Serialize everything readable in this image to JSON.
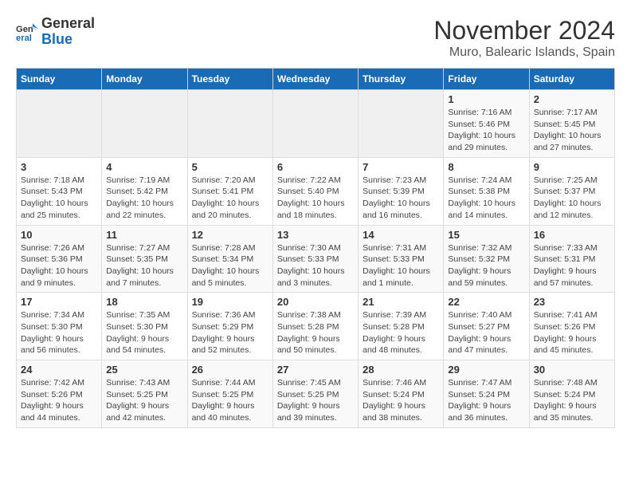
{
  "logo": {
    "line1": "General",
    "line2": "Blue"
  },
  "title": "November 2024",
  "location": "Muro, Balearic Islands, Spain",
  "days_of_week": [
    "Sunday",
    "Monday",
    "Tuesday",
    "Wednesday",
    "Thursday",
    "Friday",
    "Saturday"
  ],
  "weeks": [
    [
      {
        "day": "",
        "info": ""
      },
      {
        "day": "",
        "info": ""
      },
      {
        "day": "",
        "info": ""
      },
      {
        "day": "",
        "info": ""
      },
      {
        "day": "",
        "info": ""
      },
      {
        "day": "1",
        "info": "Sunrise: 7:16 AM\nSunset: 5:46 PM\nDaylight: 10 hours and 29 minutes."
      },
      {
        "day": "2",
        "info": "Sunrise: 7:17 AM\nSunset: 5:45 PM\nDaylight: 10 hours and 27 minutes."
      }
    ],
    [
      {
        "day": "3",
        "info": "Sunrise: 7:18 AM\nSunset: 5:43 PM\nDaylight: 10 hours and 25 minutes."
      },
      {
        "day": "4",
        "info": "Sunrise: 7:19 AM\nSunset: 5:42 PM\nDaylight: 10 hours and 22 minutes."
      },
      {
        "day": "5",
        "info": "Sunrise: 7:20 AM\nSunset: 5:41 PM\nDaylight: 10 hours and 20 minutes."
      },
      {
        "day": "6",
        "info": "Sunrise: 7:22 AM\nSunset: 5:40 PM\nDaylight: 10 hours and 18 minutes."
      },
      {
        "day": "7",
        "info": "Sunrise: 7:23 AM\nSunset: 5:39 PM\nDaylight: 10 hours and 16 minutes."
      },
      {
        "day": "8",
        "info": "Sunrise: 7:24 AM\nSunset: 5:38 PM\nDaylight: 10 hours and 14 minutes."
      },
      {
        "day": "9",
        "info": "Sunrise: 7:25 AM\nSunset: 5:37 PM\nDaylight: 10 hours and 12 minutes."
      }
    ],
    [
      {
        "day": "10",
        "info": "Sunrise: 7:26 AM\nSunset: 5:36 PM\nDaylight: 10 hours and 9 minutes."
      },
      {
        "day": "11",
        "info": "Sunrise: 7:27 AM\nSunset: 5:35 PM\nDaylight: 10 hours and 7 minutes."
      },
      {
        "day": "12",
        "info": "Sunrise: 7:28 AM\nSunset: 5:34 PM\nDaylight: 10 hours and 5 minutes."
      },
      {
        "day": "13",
        "info": "Sunrise: 7:30 AM\nSunset: 5:33 PM\nDaylight: 10 hours and 3 minutes."
      },
      {
        "day": "14",
        "info": "Sunrise: 7:31 AM\nSunset: 5:33 PM\nDaylight: 10 hours and 1 minute."
      },
      {
        "day": "15",
        "info": "Sunrise: 7:32 AM\nSunset: 5:32 PM\nDaylight: 9 hours and 59 minutes."
      },
      {
        "day": "16",
        "info": "Sunrise: 7:33 AM\nSunset: 5:31 PM\nDaylight: 9 hours and 57 minutes."
      }
    ],
    [
      {
        "day": "17",
        "info": "Sunrise: 7:34 AM\nSunset: 5:30 PM\nDaylight: 9 hours and 56 minutes."
      },
      {
        "day": "18",
        "info": "Sunrise: 7:35 AM\nSunset: 5:30 PM\nDaylight: 9 hours and 54 minutes."
      },
      {
        "day": "19",
        "info": "Sunrise: 7:36 AM\nSunset: 5:29 PM\nDaylight: 9 hours and 52 minutes."
      },
      {
        "day": "20",
        "info": "Sunrise: 7:38 AM\nSunset: 5:28 PM\nDaylight: 9 hours and 50 minutes."
      },
      {
        "day": "21",
        "info": "Sunrise: 7:39 AM\nSunset: 5:28 PM\nDaylight: 9 hours and 48 minutes."
      },
      {
        "day": "22",
        "info": "Sunrise: 7:40 AM\nSunset: 5:27 PM\nDaylight: 9 hours and 47 minutes."
      },
      {
        "day": "23",
        "info": "Sunrise: 7:41 AM\nSunset: 5:26 PM\nDaylight: 9 hours and 45 minutes."
      }
    ],
    [
      {
        "day": "24",
        "info": "Sunrise: 7:42 AM\nSunset: 5:26 PM\nDaylight: 9 hours and 44 minutes."
      },
      {
        "day": "25",
        "info": "Sunrise: 7:43 AM\nSunset: 5:25 PM\nDaylight: 9 hours and 42 minutes."
      },
      {
        "day": "26",
        "info": "Sunrise: 7:44 AM\nSunset: 5:25 PM\nDaylight: 9 hours and 40 minutes."
      },
      {
        "day": "27",
        "info": "Sunrise: 7:45 AM\nSunset: 5:25 PM\nDaylight: 9 hours and 39 minutes."
      },
      {
        "day": "28",
        "info": "Sunrise: 7:46 AM\nSunset: 5:24 PM\nDaylight: 9 hours and 38 minutes."
      },
      {
        "day": "29",
        "info": "Sunrise: 7:47 AM\nSunset: 5:24 PM\nDaylight: 9 hours and 36 minutes."
      },
      {
        "day": "30",
        "info": "Sunrise: 7:48 AM\nSunset: 5:24 PM\nDaylight: 9 hours and 35 minutes."
      }
    ]
  ]
}
